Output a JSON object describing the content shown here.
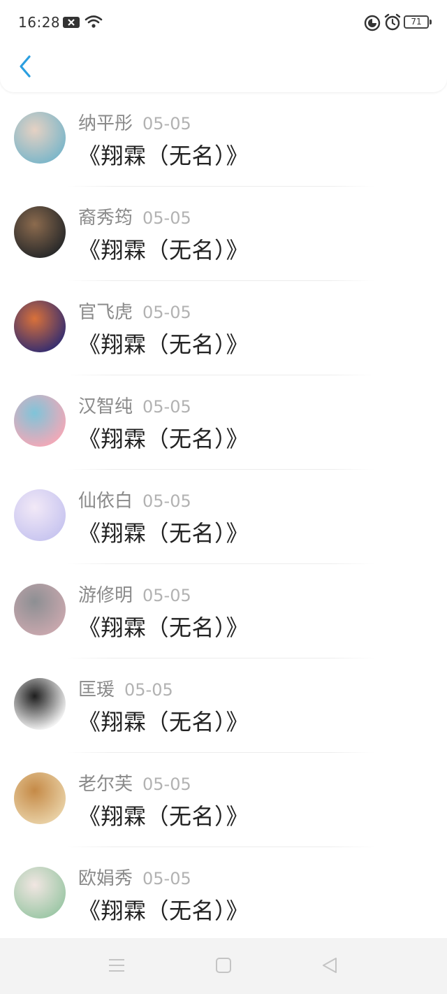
{
  "status_bar": {
    "time": "16:28",
    "battery": "71"
  },
  "header": {
    "back_icon": "chevron-left-icon",
    "accent_color": "#2b9fe0"
  },
  "items": [
    {
      "name": "纳平彤",
      "date": "05-05",
      "title": "《翔霖（无名）》",
      "avatar_colors": [
        "#7fb7c9",
        "#e5d1c3"
      ]
    },
    {
      "name": "裔秀筠",
      "date": "05-05",
      "title": "《翔霖（无名）》",
      "avatar_colors": [
        "#2a2a2a",
        "#8c6b4e"
      ]
    },
    {
      "name": "官飞虎",
      "date": "05-05",
      "title": "《翔霖（无名）》",
      "avatar_colors": [
        "#3a2f6e",
        "#d9713a"
      ]
    },
    {
      "name": "汉智纯",
      "date": "05-05",
      "title": "《翔霖（无名）》",
      "avatar_colors": [
        "#f0a9b8",
        "#7fc4d9"
      ]
    },
    {
      "name": "仙依白",
      "date": "05-05",
      "title": "《翔霖（无名）》",
      "avatar_colors": [
        "#c9c6f0",
        "#f2e9f7"
      ]
    },
    {
      "name": "游修明",
      "date": "05-05",
      "title": "《翔霖（无名）》",
      "avatar_colors": [
        "#c7a7ad",
        "#8d8f93"
      ]
    },
    {
      "name": "匡瑗",
      "date": "05-05",
      "title": "《翔霖（无名）》",
      "avatar_colors": [
        "#f2f2f2",
        "#1e1e1e"
      ]
    },
    {
      "name": "老尔芙",
      "date": "05-05",
      "title": "《翔霖（无名）》",
      "avatar_colors": [
        "#e8cfa3",
        "#c58a47"
      ]
    },
    {
      "name": "欧娟秀",
      "date": "05-05",
      "title": "《翔霖（无名）》",
      "avatar_colors": [
        "#9fc8a8",
        "#f1e6e2"
      ]
    }
  ],
  "nav_bar": {
    "menu_icon": "menu-icon",
    "home_icon": "square-home-icon",
    "back_icon": "triangle-back-icon"
  }
}
